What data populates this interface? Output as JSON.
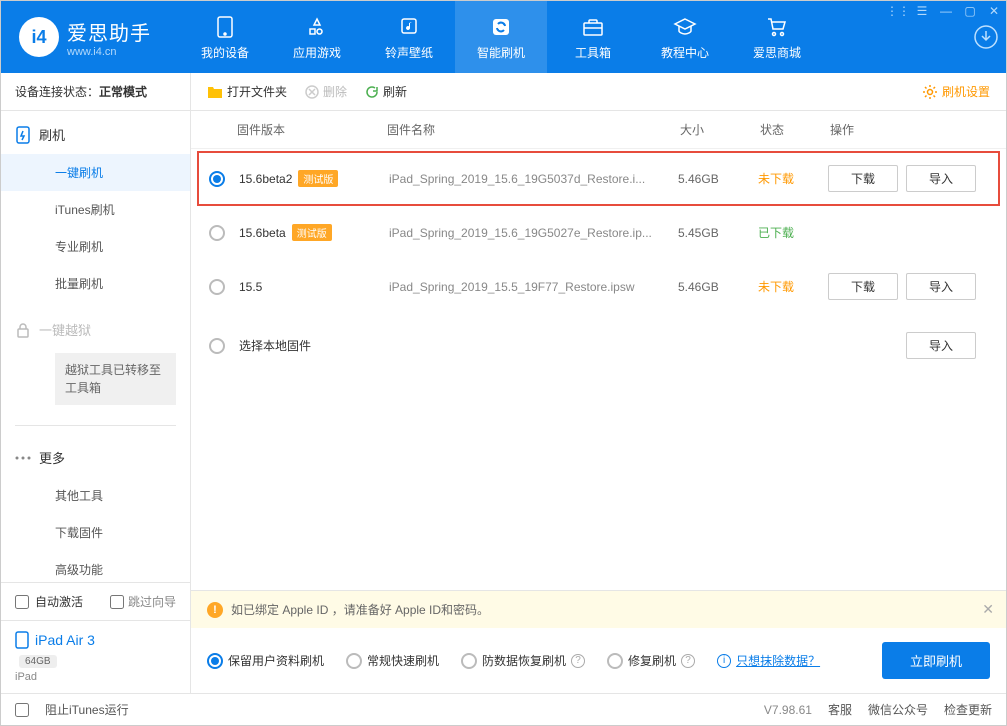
{
  "app": {
    "title": "爱思助手",
    "subtitle": "www.i4.cn"
  },
  "nav": {
    "tabs": [
      {
        "label": "我的设备"
      },
      {
        "label": "应用游戏"
      },
      {
        "label": "铃声壁纸"
      },
      {
        "label": "智能刷机"
      },
      {
        "label": "工具箱"
      },
      {
        "label": "教程中心"
      },
      {
        "label": "爱思商城"
      }
    ]
  },
  "sidebar": {
    "conn_status_label": "设备连接状态：",
    "conn_status_value": "正常模式",
    "flash_head": "刷机",
    "items": {
      "one_key": "一键刷机",
      "itunes": "iTunes刷机",
      "pro": "专业刷机",
      "batch": "批量刷机"
    },
    "jailbreak_head": "一键越狱",
    "jailbreak_note": "越狱工具已转移至工具箱",
    "more_head": "更多",
    "more_items": {
      "other_tools": "其他工具",
      "download_fw": "下载固件",
      "advanced": "高级功能"
    },
    "auto_activate": "自动激活",
    "skip_guide": "跳过向导",
    "device_name": "iPad Air 3",
    "device_storage": "64GB",
    "device_type": "iPad"
  },
  "toolbar": {
    "open_folder": "打开文件夹",
    "delete": "删除",
    "refresh": "刷新",
    "settings": "刷机设置"
  },
  "table": {
    "headers": {
      "version": "固件版本",
      "name": "固件名称",
      "size": "大小",
      "status": "状态",
      "actions": "操作"
    },
    "rows": [
      {
        "selected": true,
        "version": "15.6beta2",
        "beta": "测试版",
        "name": "iPad_Spring_2019_15.6_19G5037d_Restore.i...",
        "size": "5.46GB",
        "status": "未下载",
        "status_class": "status-notdl",
        "show_actions": true
      },
      {
        "selected": false,
        "version": "15.6beta",
        "beta": "测试版",
        "name": "iPad_Spring_2019_15.6_19G5027e_Restore.ip...",
        "size": "5.45GB",
        "status": "已下载",
        "status_class": "status-dl",
        "show_actions": false
      },
      {
        "selected": false,
        "version": "15.5",
        "beta": "",
        "name": "iPad_Spring_2019_15.5_19F77_Restore.ipsw",
        "size": "5.46GB",
        "status": "未下载",
        "status_class": "status-notdl",
        "show_actions": true
      }
    ],
    "local_row": "选择本地固件",
    "btn_download": "下载",
    "btn_import": "导入"
  },
  "bottom": {
    "notice": "如已绑定 Apple ID ，请准备好 Apple ID和密码。",
    "options": {
      "keep_data": "保留用户资料刷机",
      "normal": "常规快速刷机",
      "anti_loss": "防数据恢复刷机",
      "repair": "修复刷机"
    },
    "erase_link": "只想抹除数据？",
    "flash_now": "立即刷机"
  },
  "footer": {
    "block_itunes": "阻止iTunes运行",
    "version": "V7.98.61",
    "support": "客服",
    "wechat": "微信公众号",
    "check_update": "检查更新"
  }
}
